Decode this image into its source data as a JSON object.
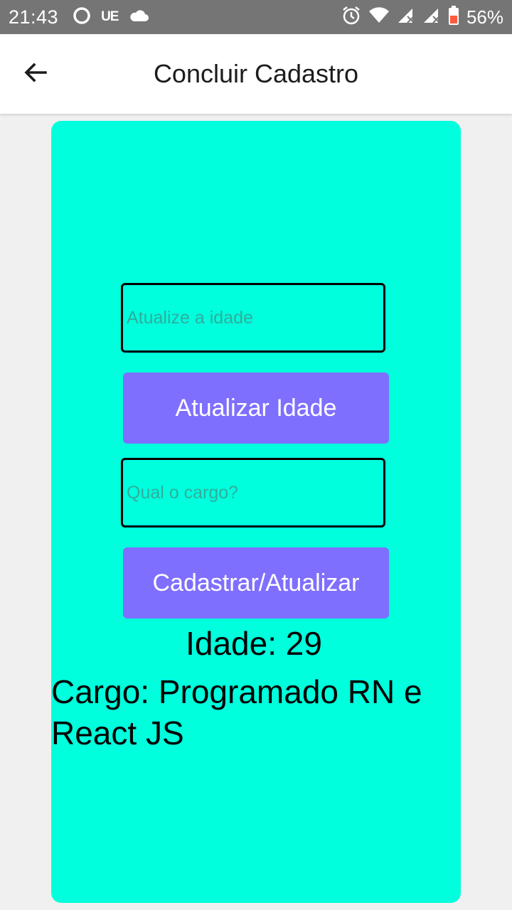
{
  "status_bar": {
    "time": "21:43",
    "carrier_badge": "UE",
    "battery_percent": "56%",
    "icons": [
      "circle-notification-icon",
      "cloud-icon",
      "alarm-icon",
      "wifi-icon",
      "signal-icon",
      "signal-icon-2",
      "battery-icon"
    ]
  },
  "app_bar": {
    "title": "Concluir Cadastro",
    "back_icon": "arrow-left-icon"
  },
  "form": {
    "age_input": {
      "placeholder": "Atualize a idade",
      "value": ""
    },
    "update_age_button": "Atualizar Idade",
    "role_input": {
      "placeholder": "Qual o cargo?",
      "value": ""
    },
    "register_button": "Cadastrar/Atualizar"
  },
  "result": {
    "age_line": "Idade: 29",
    "role_line": "Cargo: Programado RN e React JS"
  },
  "colors": {
    "card_background": "#00ffdd",
    "button_background": "#7f6ffe",
    "status_bar": "#757575",
    "page_background": "#f0f0f0"
  }
}
